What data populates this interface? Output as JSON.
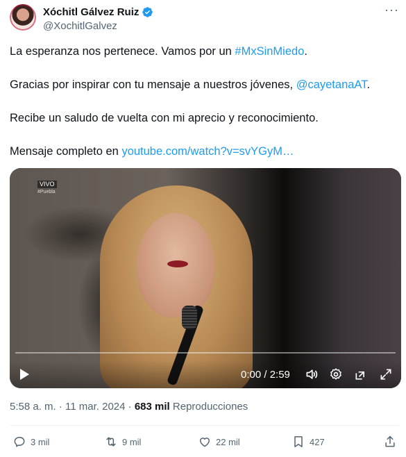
{
  "author": {
    "name": "Xóchitl Gálvez Ruiz",
    "handle": "@XochitlGalvez"
  },
  "tweet": {
    "line1_text": "La esperanza nos pertenece. Vamos por un ",
    "line1_hashtag": "#MxSinMiedo",
    "line1_end": ".",
    "line2_text": "Gracias por inspirar con tu mensaje a nuestros jóvenes, ",
    "line2_mention": "@cayetanaAT",
    "line2_end": ".",
    "line3_text": "Recibe un saludo de vuelta con mi aprecio y reconocimiento.",
    "line4_text": "Mensaje completo en ",
    "line4_link": "youtube.com/watch?v=svYGyM…"
  },
  "video": {
    "live_label": "VIVO",
    "location_label": "#Puebla",
    "time_display": "0:00 / 2:59",
    "progress": 0
  },
  "meta": {
    "time": "5:58 a. m.",
    "separator": "·",
    "date": "11 mar. 2024",
    "views_count": "683 mil",
    "views_label": "Reproducciones"
  },
  "actions": {
    "replies": "3 mil",
    "reposts": "9 mil",
    "likes": "22 mil",
    "bookmarks": "427"
  },
  "colors": {
    "accent": "#1d9bf0",
    "text_primary": "#0f1419",
    "text_secondary": "#536471",
    "verified": "#1d9bf0"
  }
}
